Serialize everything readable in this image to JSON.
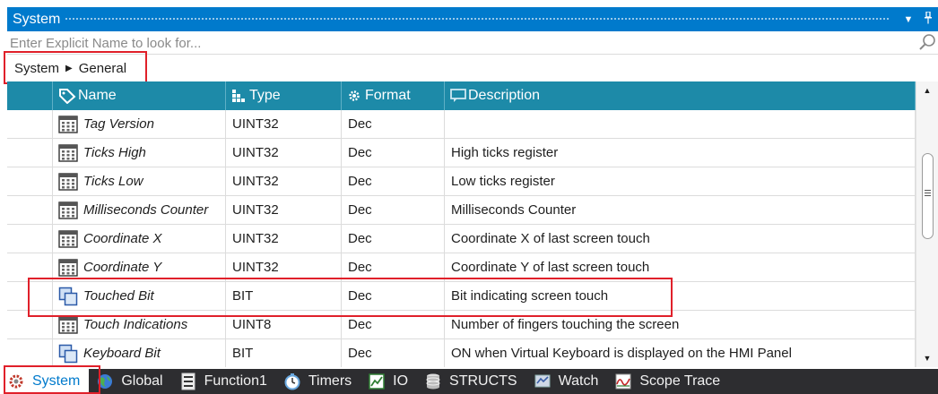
{
  "panel": {
    "title": "System"
  },
  "search": {
    "placeholder": "Enter Explicit Name to look for...",
    "value": ""
  },
  "breadcrumb": {
    "root": "System",
    "current": "General"
  },
  "table": {
    "columns": [
      "Name",
      "Type",
      "Format",
      "Description"
    ],
    "rows": [
      {
        "name": "Tag Version",
        "type": "UINT32",
        "format": "Dec",
        "description": "",
        "icon": "register-icon"
      },
      {
        "name": "Ticks High",
        "type": "UINT32",
        "format": "Dec",
        "description": "High ticks register",
        "icon": "register-icon"
      },
      {
        "name": "Ticks Low",
        "type": "UINT32",
        "format": "Dec",
        "description": "Low ticks register",
        "icon": "register-icon"
      },
      {
        "name": "Milliseconds Counter",
        "type": "UINT32",
        "format": "Dec",
        "description": "Milliseconds Counter",
        "icon": "register-icon"
      },
      {
        "name": "Coordinate X",
        "type": "UINT32",
        "format": "Dec",
        "description": "Coordinate X of last screen touch",
        "icon": "register-icon"
      },
      {
        "name": "Coordinate Y",
        "type": "UINT32",
        "format": "Dec",
        "description": "Coordinate Y of last screen touch",
        "icon": "register-icon"
      },
      {
        "name": "Touched Bit",
        "type": "BIT",
        "format": "Dec",
        "description": "Bit indicating screen touch",
        "icon": "bit-icon"
      },
      {
        "name": "Touch Indications",
        "type": "UINT8",
        "format": "Dec",
        "description": "Number of fingers touching the screen",
        "icon": "register-icon"
      },
      {
        "name": "Keyboard Bit",
        "type": "BIT",
        "format": "Dec",
        "description": "ON when Virtual Keyboard is displayed on the HMI Panel",
        "icon": "bit-icon"
      }
    ]
  },
  "bottom_tabs": [
    {
      "label": "System",
      "icon": "gear-icon",
      "active": true
    },
    {
      "label": "Global",
      "icon": "globe-icon",
      "active": false
    },
    {
      "label": "Function1",
      "icon": "function-icon",
      "active": false
    },
    {
      "label": "Timers",
      "icon": "timer-icon",
      "active": false
    },
    {
      "label": "IO",
      "icon": "io-icon",
      "active": false
    },
    {
      "label": "STRUCTS",
      "icon": "structs-icon",
      "active": false
    },
    {
      "label": "Watch",
      "icon": "watch-icon",
      "active": false
    },
    {
      "label": "Scope Trace",
      "icon": "scope-trace-icon",
      "active": false
    }
  ],
  "colors": {
    "accent": "#007acc",
    "header": "#1d8aa8",
    "highlight_box": "#e0202a",
    "bottom_bar": "#2d2d30"
  }
}
